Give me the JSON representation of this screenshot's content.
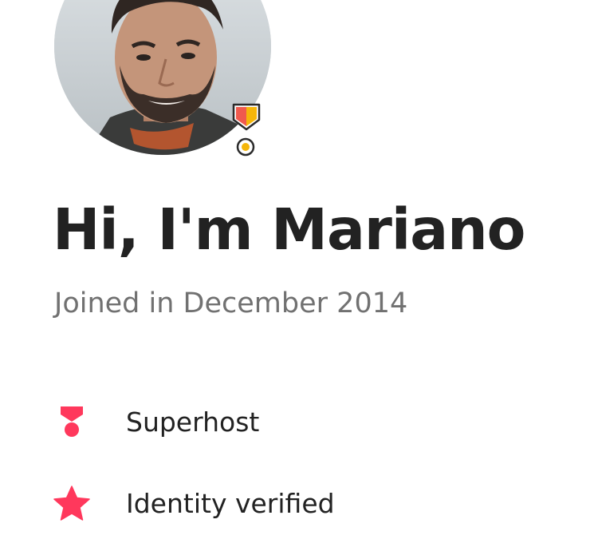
{
  "profile": {
    "greeting": "Hi, I'm Mariano",
    "joined": "Joined in December 2014",
    "avatar_icon": "profile-photo",
    "badge_icon": "superhost-medal-icon"
  },
  "highlights": [
    {
      "icon": "superhost-icon",
      "label": "Superhost"
    },
    {
      "icon": "star-icon",
      "label": "Identity verified"
    }
  ],
  "colors": {
    "brand": "#FF385C",
    "text_primary": "#222222",
    "text_secondary": "#717171",
    "badge_gold": "#F5B60A",
    "badge_coral": "#F05A4E"
  }
}
